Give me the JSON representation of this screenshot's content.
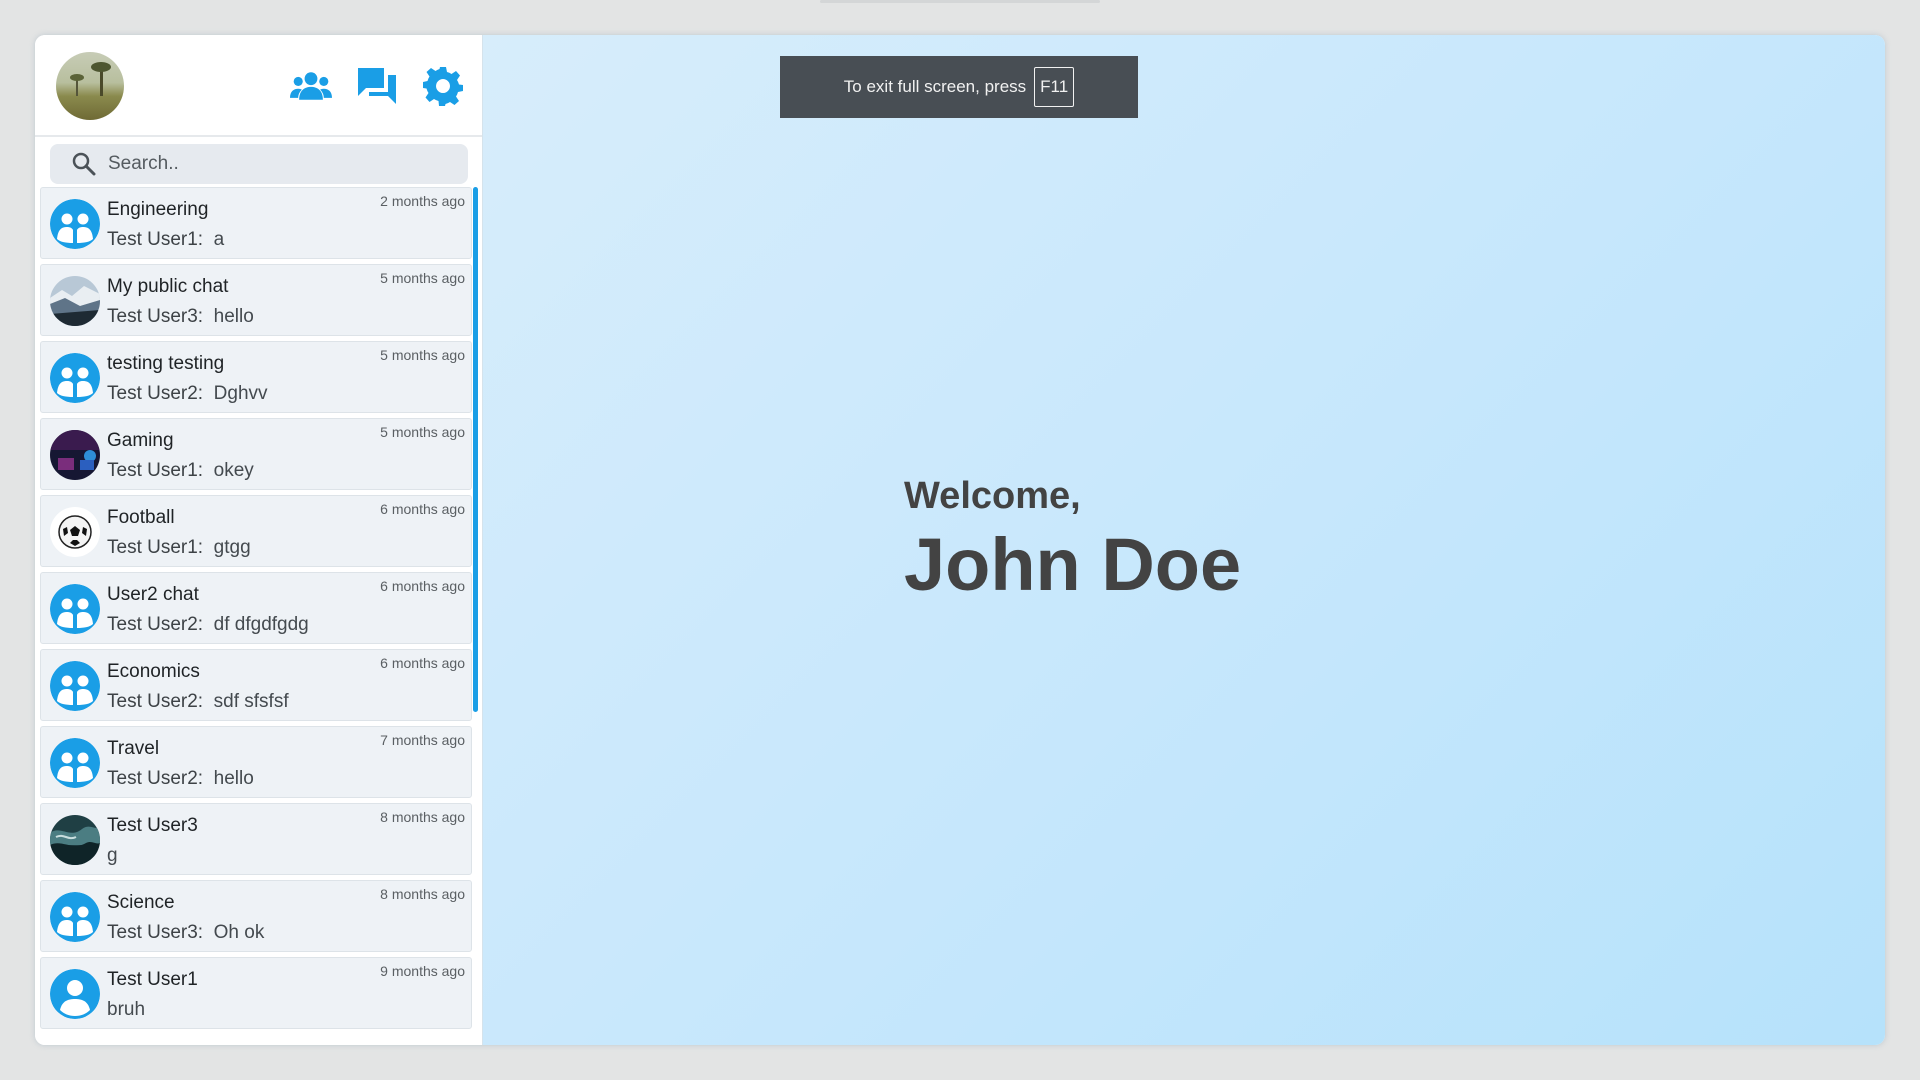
{
  "search": {
    "placeholder": "Search.."
  },
  "header": {
    "icons": [
      "contacts-icon",
      "chats-icon",
      "settings-icon"
    ]
  },
  "chats": [
    {
      "name": "Engineering",
      "sender": "Test User1:",
      "message": "a",
      "time": "2 months ago",
      "avatar": "group"
    },
    {
      "name": "My public chat",
      "sender": "Test User3:",
      "message": "hello",
      "time": "5 months ago",
      "avatar": "photo-mountains"
    },
    {
      "name": "testing testing",
      "sender": "Test User2:",
      "message": "Dghvv",
      "time": "5 months ago",
      "avatar": "group"
    },
    {
      "name": "Gaming",
      "sender": "Test User1:",
      "message": "okey",
      "time": "5 months ago",
      "avatar": "photo-gaming"
    },
    {
      "name": "Football",
      "sender": "Test User1:",
      "message": "gtgg",
      "time": "6 months ago",
      "avatar": "photo-football"
    },
    {
      "name": "User2 chat",
      "sender": "Test User2:",
      "message": "df dfgdfgdg",
      "time": "6 months ago",
      "avatar": "group"
    },
    {
      "name": "Economics",
      "sender": "Test User2:",
      "message": "sdf sfsfsf",
      "time": "6 months ago",
      "avatar": "group"
    },
    {
      "name": "Travel",
      "sender": "Test User2:",
      "message": "hello",
      "time": "7 months ago",
      "avatar": "group"
    },
    {
      "name": "Test User3",
      "sender": "",
      "message": "g",
      "time": "8 months ago",
      "avatar": "photo-waves"
    },
    {
      "name": "Science",
      "sender": "Test User3:",
      "message": "Oh ok",
      "time": "8 months ago",
      "avatar": "group"
    },
    {
      "name": "Test User1",
      "sender": "",
      "message": "bruh",
      "time": "9 months ago",
      "avatar": "user"
    }
  ],
  "fullscreen_notice": {
    "text": "To exit full screen, press",
    "key": "F11"
  },
  "welcome": {
    "label": "Welcome,",
    "name": "John Doe"
  },
  "colors": {
    "accent": "#1a9ee6",
    "banner": "#484e54",
    "text_dark": "#434343"
  }
}
